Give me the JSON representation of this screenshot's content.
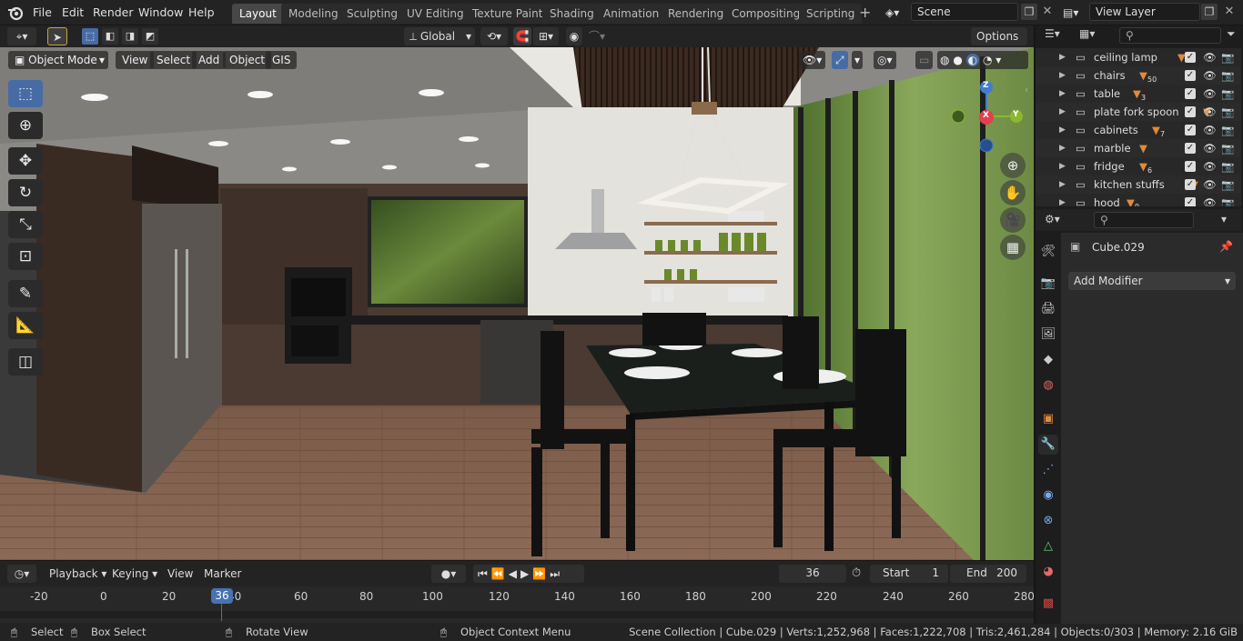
{
  "topbar": {
    "menus": [
      "File",
      "Edit",
      "Render",
      "Window",
      "Help"
    ],
    "workspaces": [
      "Layout",
      "Modeling",
      "Sculpting",
      "UV Editing",
      "Texture Paint",
      "Shading",
      "Animation",
      "Rendering",
      "Compositing",
      "Scripting"
    ],
    "scene": "Scene",
    "view_layer": "View Layer"
  },
  "tool_header": {
    "orientation": "Global",
    "options": "Options"
  },
  "viewport": {
    "mode": "Object Mode",
    "menus": [
      "View",
      "Select",
      "Add",
      "Object",
      "GIS"
    ],
    "gizmo": {
      "z": "Z",
      "y": "Y",
      "x": "X"
    }
  },
  "timeline": {
    "menus": [
      "Playback",
      "Keying",
      "View",
      "Marker"
    ],
    "current_frame": "36",
    "start_label": "Start",
    "start": "1",
    "end_label": "End",
    "end": "200",
    "ruler": [
      "-20",
      "0",
      "20",
      "40",
      "60",
      "80",
      "100",
      "120",
      "140",
      "160",
      "180",
      "200",
      "220",
      "240",
      "260",
      "280"
    ],
    "playhead": "36"
  },
  "outliner": {
    "items": [
      {
        "name": "ceiling lamp",
        "badge": ""
      },
      {
        "name": "chairs",
        "badge": "50"
      },
      {
        "name": "table",
        "badge": "3"
      },
      {
        "name": "plate fork spoon",
        "badge": ""
      },
      {
        "name": "cabinets",
        "badge": "7"
      },
      {
        "name": "marble",
        "badge": ""
      },
      {
        "name": "fridge",
        "badge": "6"
      },
      {
        "name": "kitchen stuffs",
        "badge": ""
      },
      {
        "name": "hood",
        "badge": "9"
      }
    ]
  },
  "properties": {
    "object": "Cube.029",
    "add_modifier": "Add Modifier"
  },
  "status": {
    "select": "Select",
    "box_select": "Box Select",
    "rotate": "Rotate View",
    "context": "Object Context Menu",
    "stats": "Scene Collection | Cube.029 | Verts:1,252,968 | Faces:1,222,708 | Tris:2,461,284 | Objects:0/303 | Memory: 2.16 GiB"
  },
  "colors": {
    "accent": "#4772b3",
    "active_tool": "#476ba4",
    "x_axis": "#e04050",
    "y_axis": "#8ab832",
    "z_axis": "#3f7cd6"
  }
}
